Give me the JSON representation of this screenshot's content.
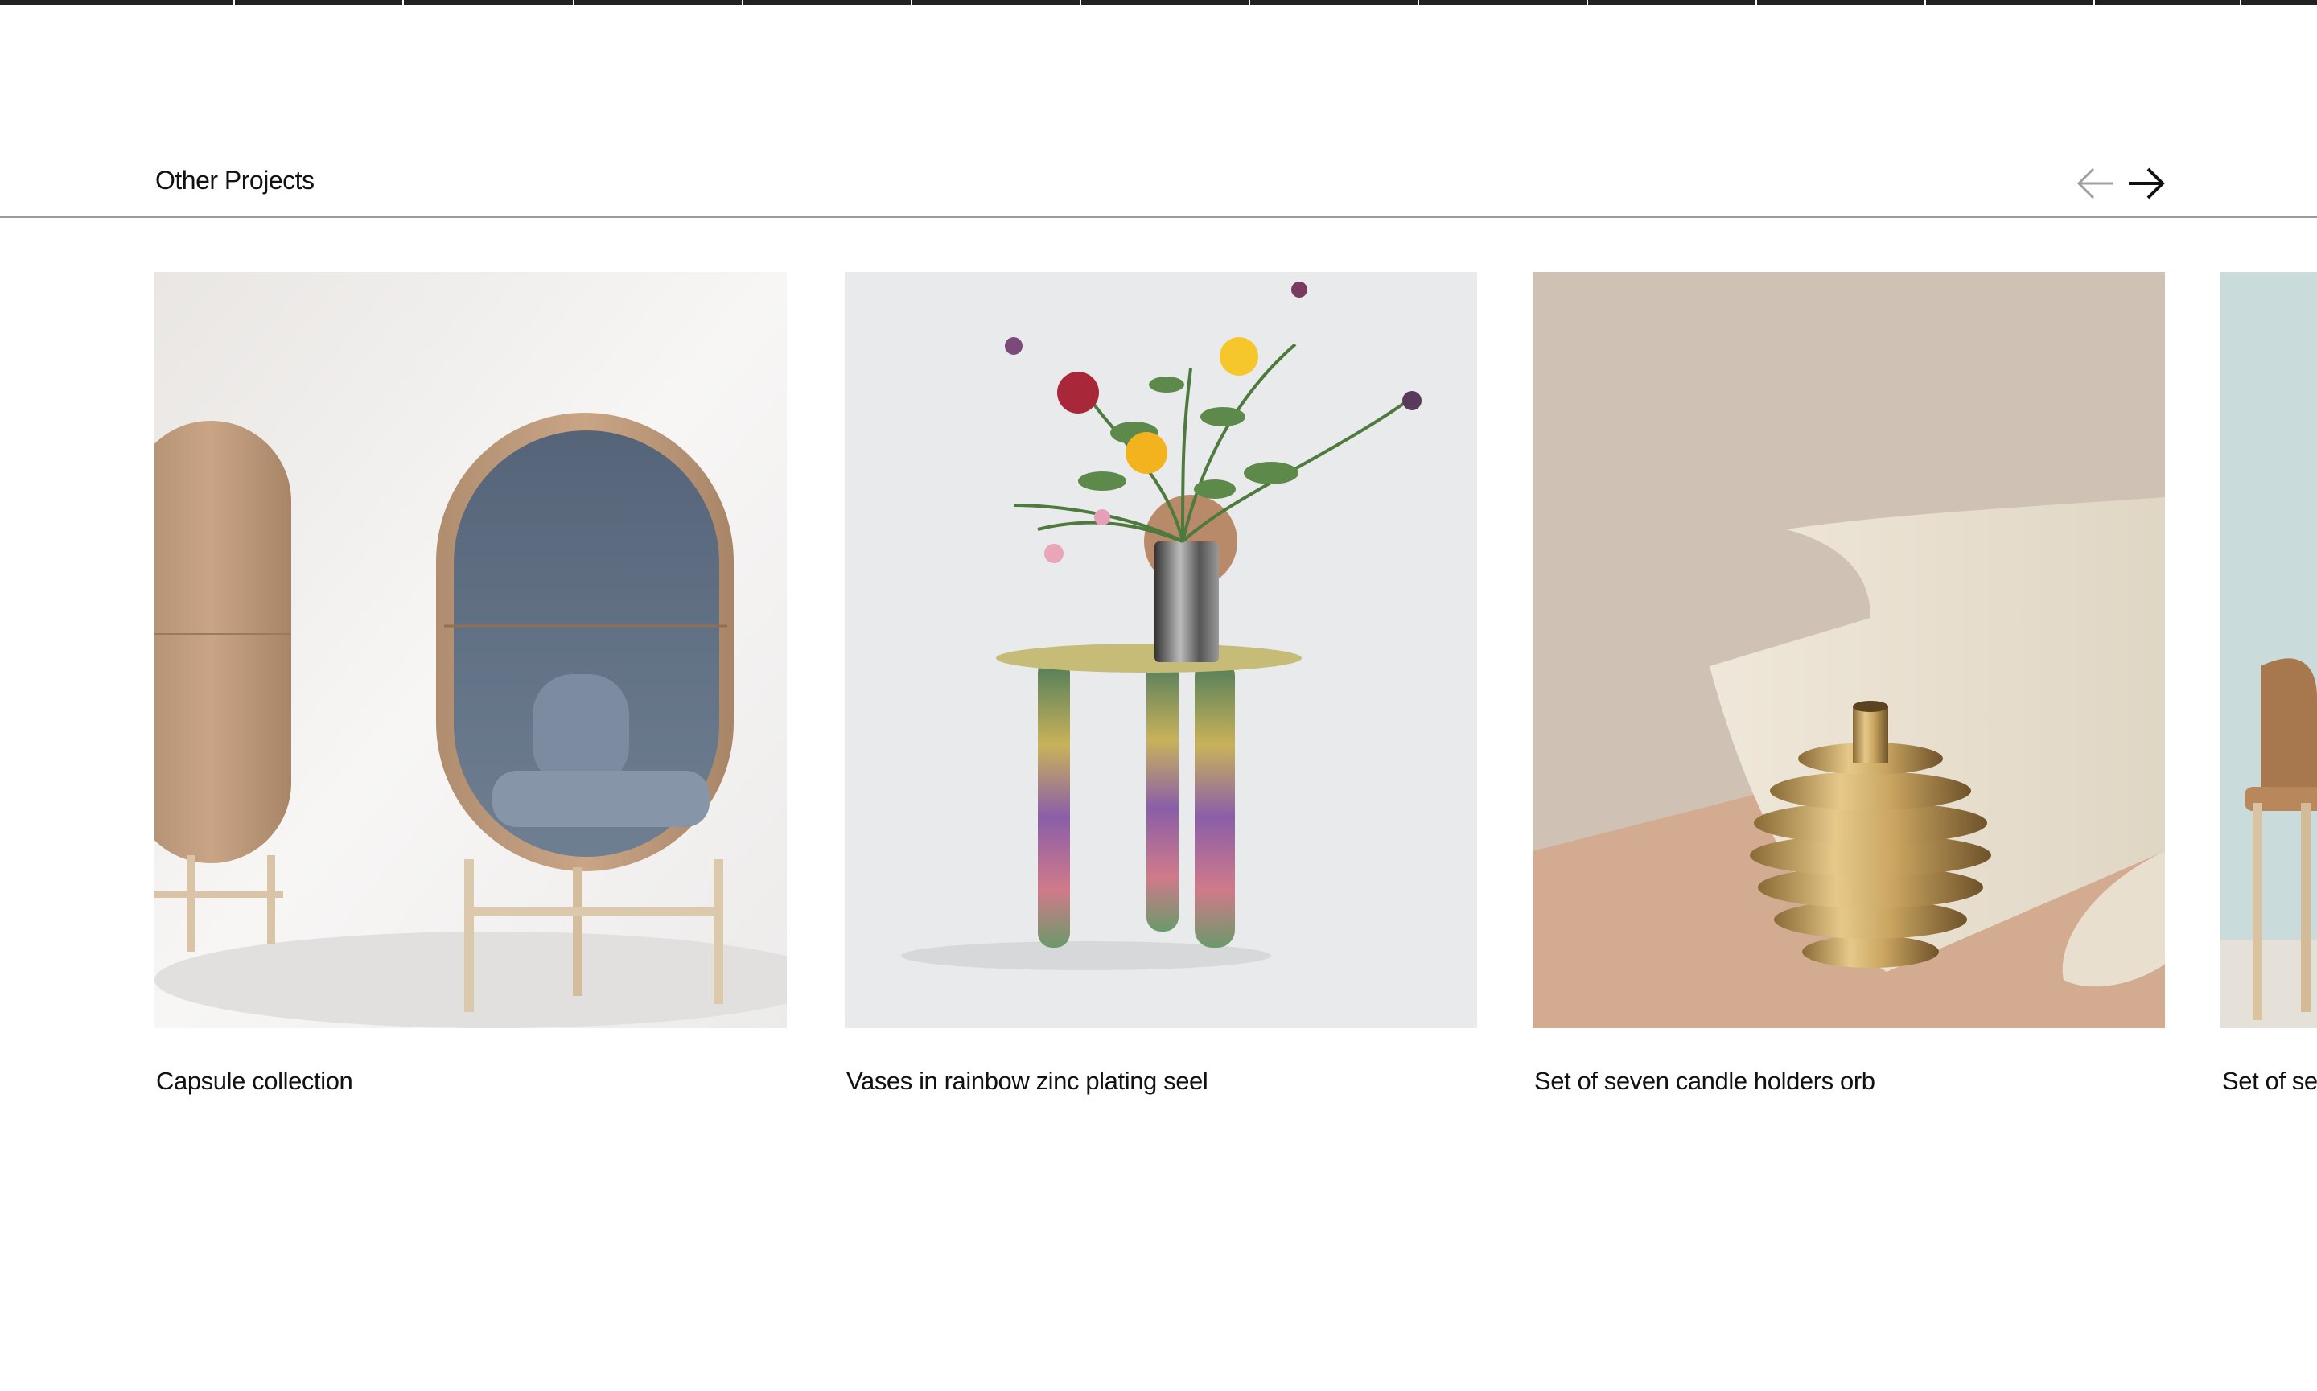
{
  "section": {
    "title": "Other Projects"
  },
  "navigation": {
    "prev_icon": "arrow-left-icon",
    "next_icon": "arrow-right-icon",
    "prev_color": "#a0a0a0",
    "next_color": "#111111"
  },
  "projects": [
    {
      "title": "Capsule collection",
      "image": "capsule-chairs"
    },
    {
      "title": "Vases in rainbow zinc plating seel",
      "image": "rainbow-vase-table"
    },
    {
      "title": "Set of seven candle holders orb",
      "image": "brass-orb-candle-holder"
    },
    {
      "title": "Set of sev",
      "image": "wooden-chair"
    }
  ]
}
